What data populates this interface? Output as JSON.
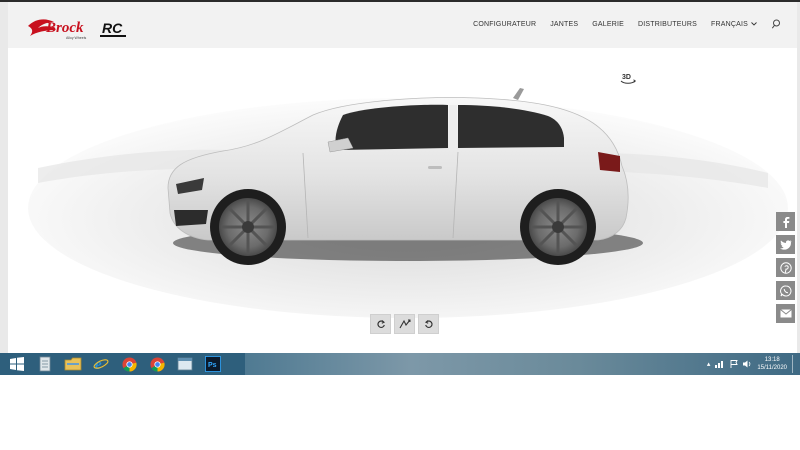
{
  "brand": {
    "logo_text": "Brock",
    "logo_sub": "Alloy Wheels",
    "logo_rc": "RC",
    "accent": "#c8101e"
  },
  "nav": {
    "items": [
      {
        "label": "CONFIGURATEUR"
      },
      {
        "label": "JANTES"
      },
      {
        "label": "GALERIE"
      },
      {
        "label": "DISTRIBUTEURS"
      }
    ],
    "language": "FRANÇAIS",
    "language_icon": "chevron-down-icon",
    "search_icon": "search-icon"
  },
  "viewer": {
    "view3d_label": "3D",
    "controls": [
      {
        "icon": "rotate-right-icon"
      },
      {
        "icon": "angle-view-icon"
      },
      {
        "icon": "rotate-left-icon"
      }
    ]
  },
  "share": [
    {
      "icon": "facebook-icon"
    },
    {
      "icon": "twitter-icon"
    },
    {
      "icon": "pinterest-icon"
    },
    {
      "icon": "whatsapp-icon"
    },
    {
      "icon": "email-icon"
    }
  ],
  "taskbar": {
    "apps": [
      {
        "icon": "windows-start-icon"
      },
      {
        "icon": "document-app-icon"
      },
      {
        "icon": "file-explorer-icon"
      },
      {
        "icon": "internet-explorer-icon"
      },
      {
        "icon": "chrome-icon"
      },
      {
        "icon": "chrome-icon"
      },
      {
        "icon": "window-app-icon"
      },
      {
        "icon": "photoshop-icon"
      }
    ],
    "photoshop_label": "Ps",
    "time": "13:18",
    "date": "15/11/2020"
  }
}
